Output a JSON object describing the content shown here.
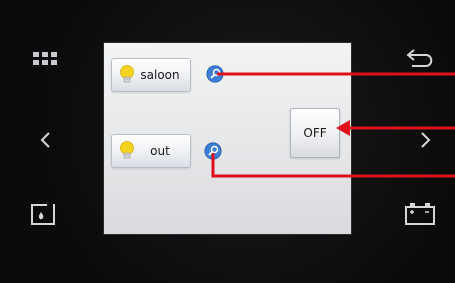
{
  "screen": {
    "scenes": [
      {
        "label": "saloon",
        "icon": "lightbulb-icon",
        "detail_icon": "magnifier-icon"
      },
      {
        "label": "out",
        "icon": "lightbulb-icon",
        "detail_icon": "magnifier-icon"
      }
    ],
    "state_button": {
      "label": "OFF"
    }
  },
  "hardware": {
    "left": [
      "grid-menu-icon",
      "chevron-left-icon",
      "water-tank-icon"
    ],
    "right": [
      "back-arrow-icon",
      "chevron-right-icon",
      "battery-icon"
    ]
  },
  "colors": {
    "annotation_arrow": "#e0101a",
    "bulb": "#f4d21f",
    "magnifier": "#3d7fd8"
  }
}
